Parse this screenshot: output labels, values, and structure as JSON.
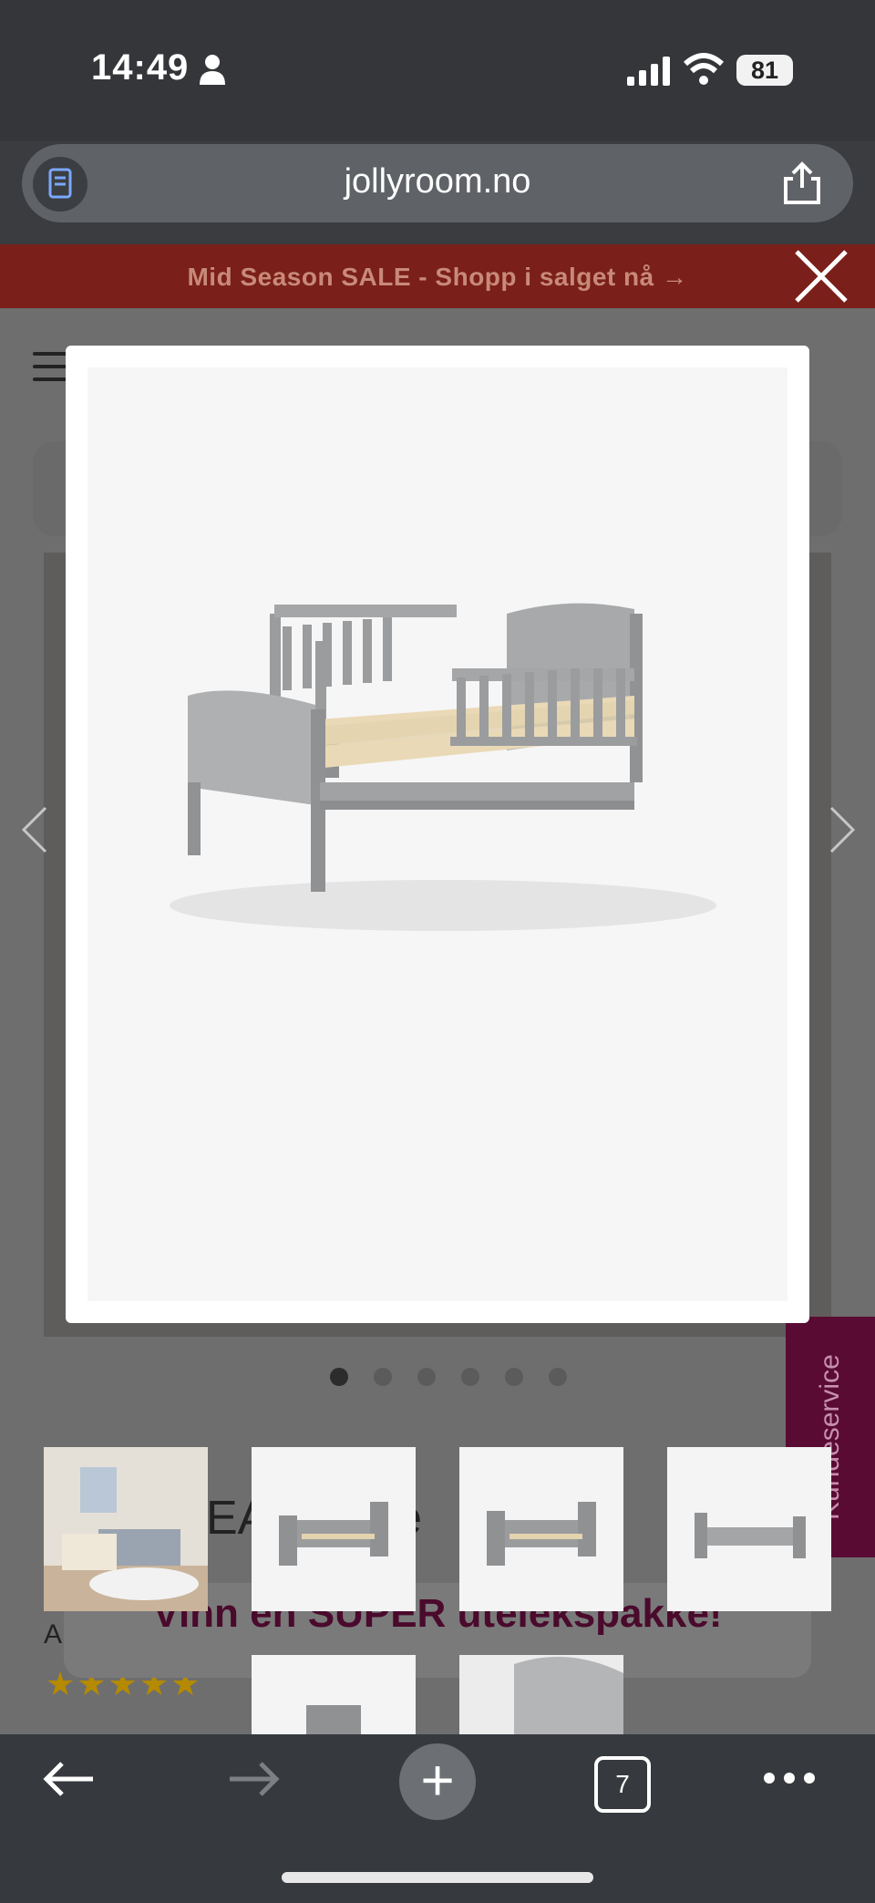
{
  "status_bar": {
    "time": "14:49",
    "battery": "81"
  },
  "browser": {
    "url": "jollyroom.no",
    "tabs_count": "7"
  },
  "page": {
    "sale_banner": "Mid Season SALE - Shopp i salget nå →",
    "product_title_partial": "EA      140      se",
    "promo_text": "Vinn en SUPER utelekspakke!",
    "kundeservice_label": "Kundeservice",
    "partial_char": "A",
    "stars": "★★★★★"
  },
  "lightbox": {
    "dot_count": 6,
    "active_dot": 0,
    "thumbnails": [
      {
        "name": "room-scene"
      },
      {
        "name": "bed-angle-left"
      },
      {
        "name": "bed-angle-left-2"
      },
      {
        "name": "bed-side"
      },
      {
        "name": "bed-headboard"
      },
      {
        "name": "bed-detail"
      }
    ]
  },
  "colors": {
    "sale_banner": "#7a1f19",
    "kundeservice": "#5a0b34",
    "bed": "#9a9c9e",
    "slats": "#e7d8b9"
  }
}
